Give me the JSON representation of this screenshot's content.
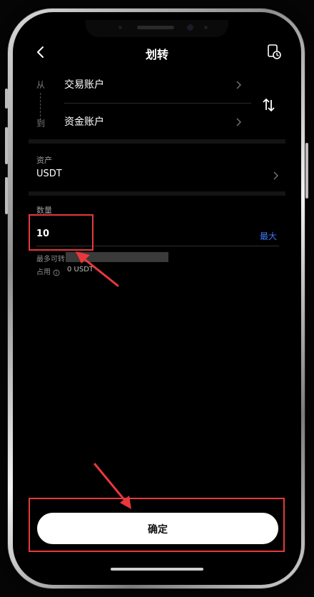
{
  "header": {
    "title": "划转",
    "back_icon": "chevron-left-icon",
    "history_icon": "record-clock-icon"
  },
  "from_to": {
    "from_label": "从",
    "to_label": "到",
    "from_account": "交易账户",
    "to_account": "资金账户",
    "swap_icon": "swap-arrows-icon"
  },
  "asset": {
    "label": "资产",
    "value": "USDT"
  },
  "amount": {
    "label": "数量",
    "value": "10",
    "max_label": "最大",
    "max_transfer_label": "最多可转",
    "occupied_label": "占用",
    "occupied_value": "0 USDT"
  },
  "confirm": {
    "label": "确定"
  },
  "colors": {
    "background": "#000000",
    "accent_blue": "#3d7bf5",
    "annotation_red": "#e8383c",
    "button_bg": "#ffffff"
  }
}
